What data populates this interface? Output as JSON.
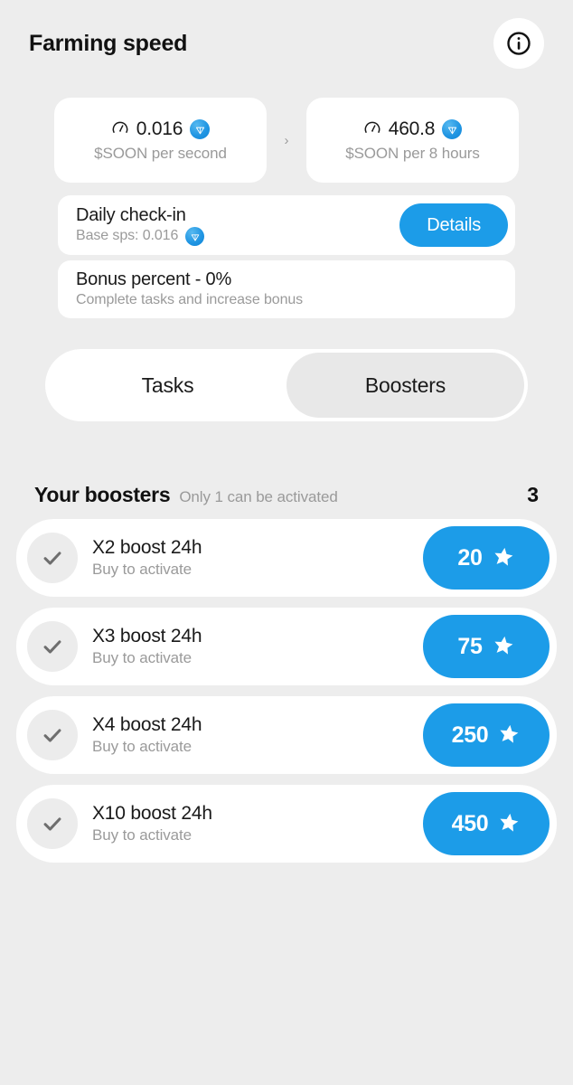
{
  "header": {
    "title": "Farming speed",
    "info_icon": "info-circle-icon"
  },
  "speed": {
    "separator": "›",
    "cards": [
      {
        "icon": "speedometer-icon",
        "value": "0.016",
        "badge": "ton-coin-icon",
        "label": "$SOON per second"
      },
      {
        "icon": "speedometer-icon",
        "value": "460.8",
        "badge": "ton-coin-icon",
        "label": "$SOON per 8 hours"
      }
    ]
  },
  "checkin": {
    "title": "Daily check-in",
    "subtitle": "Base sps: 0.016",
    "badge": "ton-coin-icon",
    "button_label": "Details"
  },
  "bonus": {
    "title": "Bonus percent - 0%",
    "subtitle": "Complete tasks and increase bonus"
  },
  "tabs": {
    "items": [
      {
        "label": "Tasks",
        "active": false
      },
      {
        "label": "Boosters",
        "active": true
      }
    ]
  },
  "boosters_section": {
    "title": "Your boosters",
    "note": "Only 1 can be activated",
    "count": "3",
    "items": [
      {
        "check_icon": "check-icon",
        "title": "X2 boost 24h",
        "subtitle": "Buy to activate",
        "price": "20",
        "price_icon": "star-icon"
      },
      {
        "check_icon": "check-icon",
        "title": "X3 boost 24h",
        "subtitle": "Buy to activate",
        "price": "75",
        "price_icon": "star-icon"
      },
      {
        "check_icon": "check-icon",
        "title": "X4 boost 24h",
        "subtitle": "Buy to activate",
        "price": "250",
        "price_icon": "star-icon"
      },
      {
        "check_icon": "check-icon",
        "title": "X10 boost 24h",
        "subtitle": "Buy to activate",
        "price": "450",
        "price_icon": "star-icon"
      }
    ]
  },
  "colors": {
    "background": "#ededed",
    "card": "#ffffff",
    "accent_blue": "#1c9ce8",
    "text_primary": "#1a1a1a",
    "text_muted": "#9a9a9a",
    "tab_active": "#e8e8e8"
  }
}
